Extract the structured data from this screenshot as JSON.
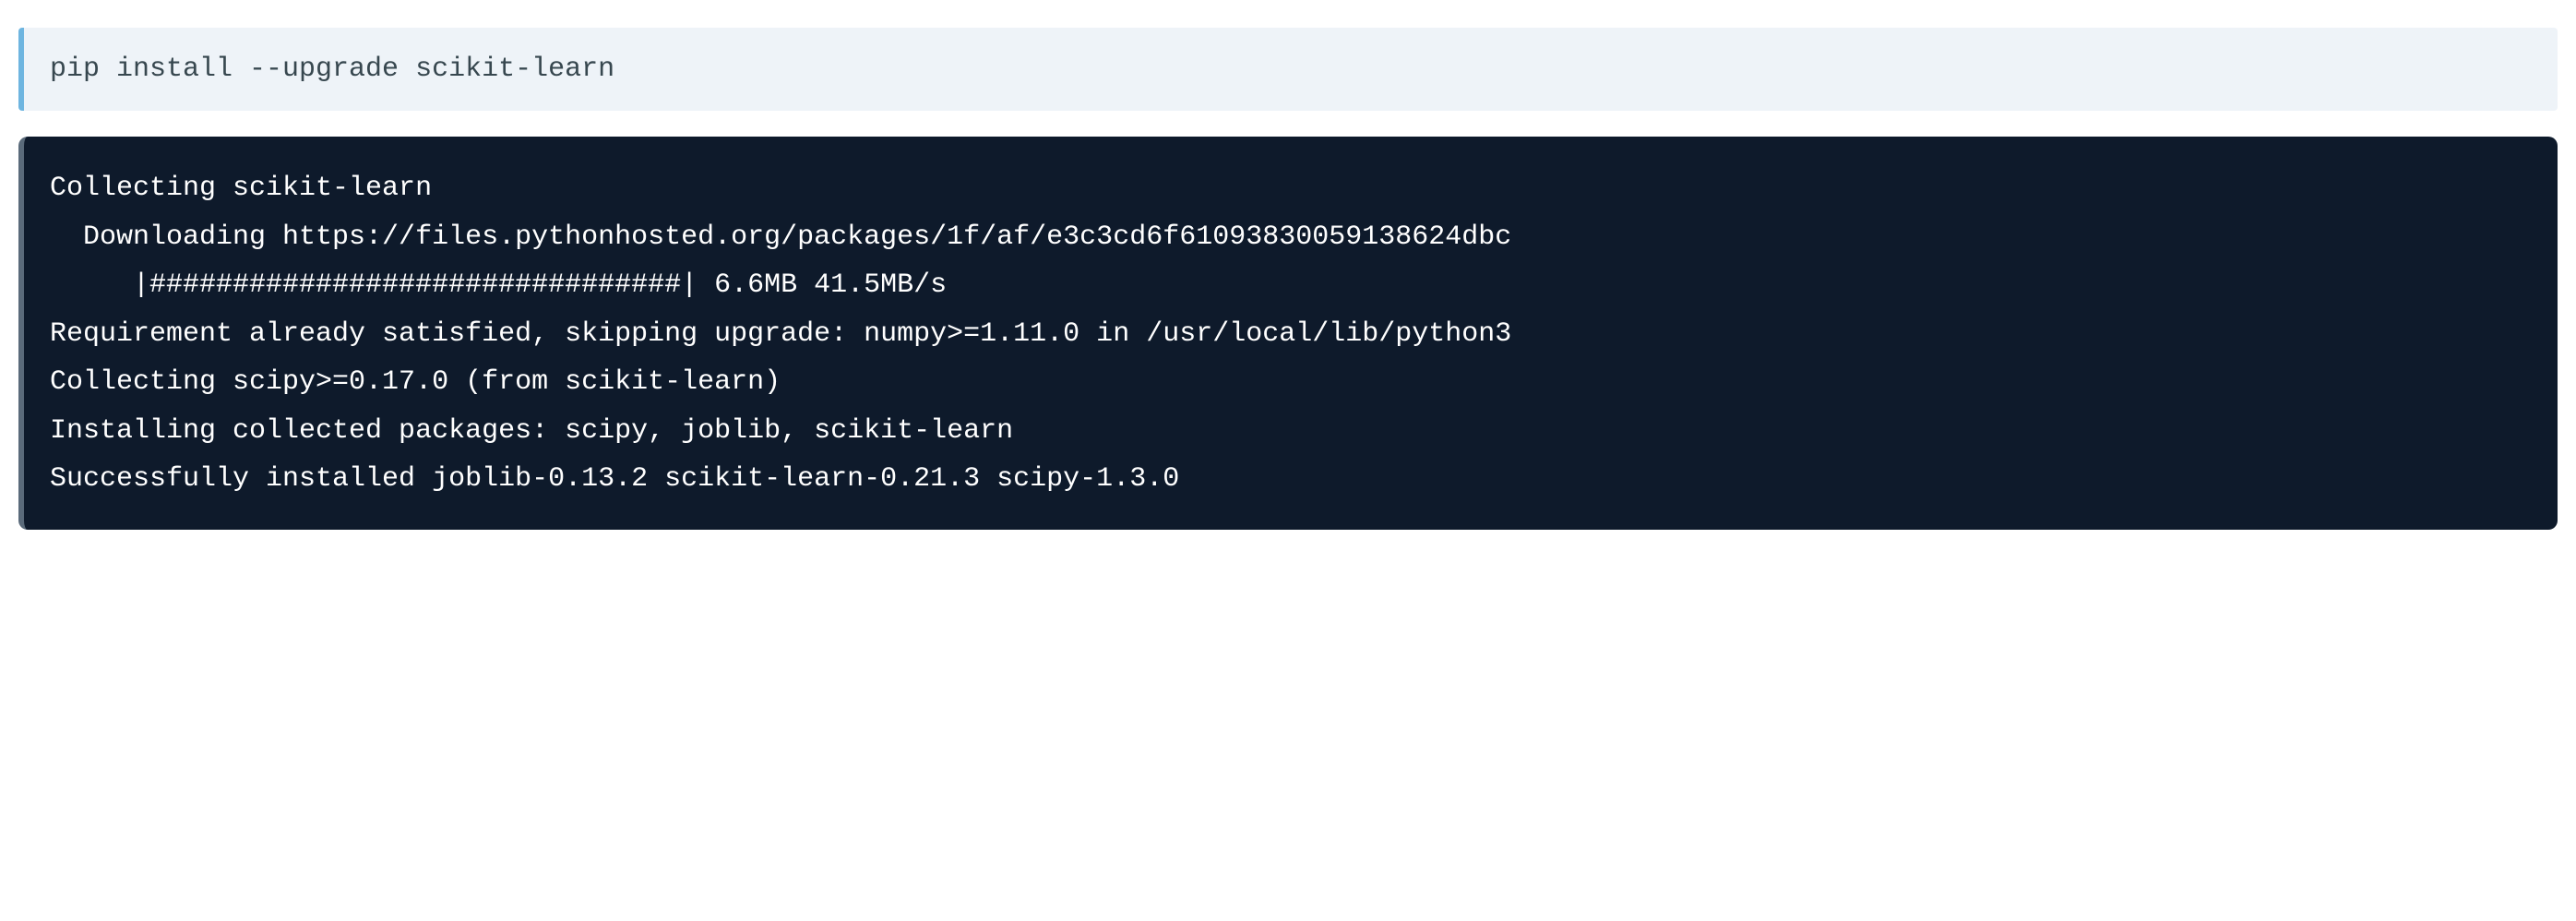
{
  "input": {
    "command": "pip install --upgrade scikit-learn"
  },
  "output": {
    "lines": [
      "Collecting scikit-learn",
      "  Downloading https://files.pythonhosted.org/packages/1f/af/e3c3cd6f61093830059138624dbc",
      "     |################################| 6.6MB 41.5MB/s ",
      "Requirement already satisfied, skipping upgrade: numpy>=1.11.0 in /usr/local/lib/python3",
      "Collecting scipy>=0.17.0 (from scikit-learn)",
      "Installing collected packages: scipy, joblib, scikit-learn",
      "Successfully installed joblib-0.13.2 scikit-learn-0.21.3 scipy-1.3.0"
    ]
  }
}
